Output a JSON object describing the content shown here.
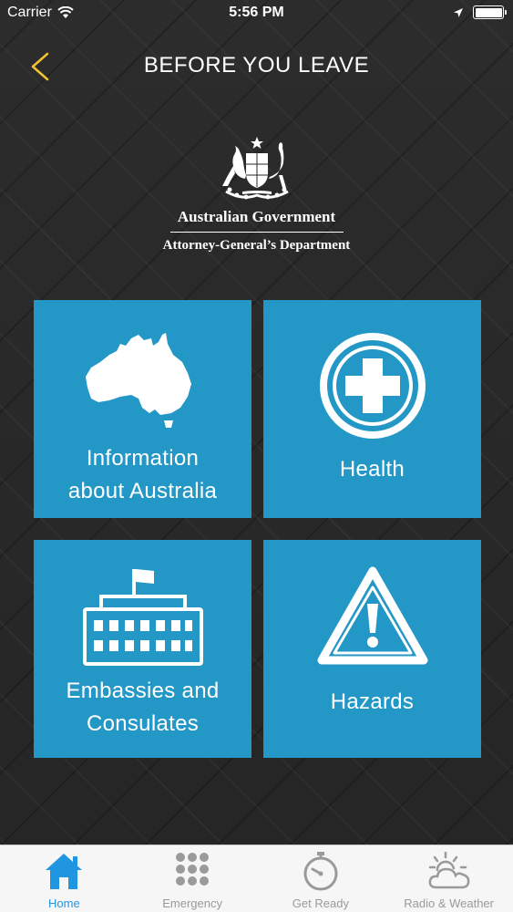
{
  "status": {
    "carrier": "Carrier",
    "time": "5:56 PM"
  },
  "nav": {
    "title": "BEFORE YOU LEAVE"
  },
  "logo": {
    "line1": "Australian Government",
    "line2": "Attorney-General’s Department"
  },
  "tiles": [
    {
      "line1": "Information",
      "line2": "about Australia",
      "icon": "australia-map-icon"
    },
    {
      "line1": "Health",
      "icon": "medical-cross-icon"
    },
    {
      "line1": "Embassies and",
      "line2": "Consulates",
      "icon": "embassy-building-icon"
    },
    {
      "line1": "Hazards",
      "icon": "warning-triangle-icon"
    }
  ],
  "tabs": [
    {
      "label": "Home",
      "icon": "home-icon",
      "active": true
    },
    {
      "label": "Emergency",
      "icon": "keypad-icon",
      "active": false
    },
    {
      "label": "Get Ready",
      "icon": "stopwatch-icon",
      "active": false
    },
    {
      "label": "Radio & Weather",
      "icon": "sun-cloud-icon",
      "active": false
    }
  ],
  "colors": {
    "tile": "#2397c6",
    "accent": "#f2c230",
    "tab_active": "#2196e0",
    "tab_inactive": "#9a9a9a"
  }
}
